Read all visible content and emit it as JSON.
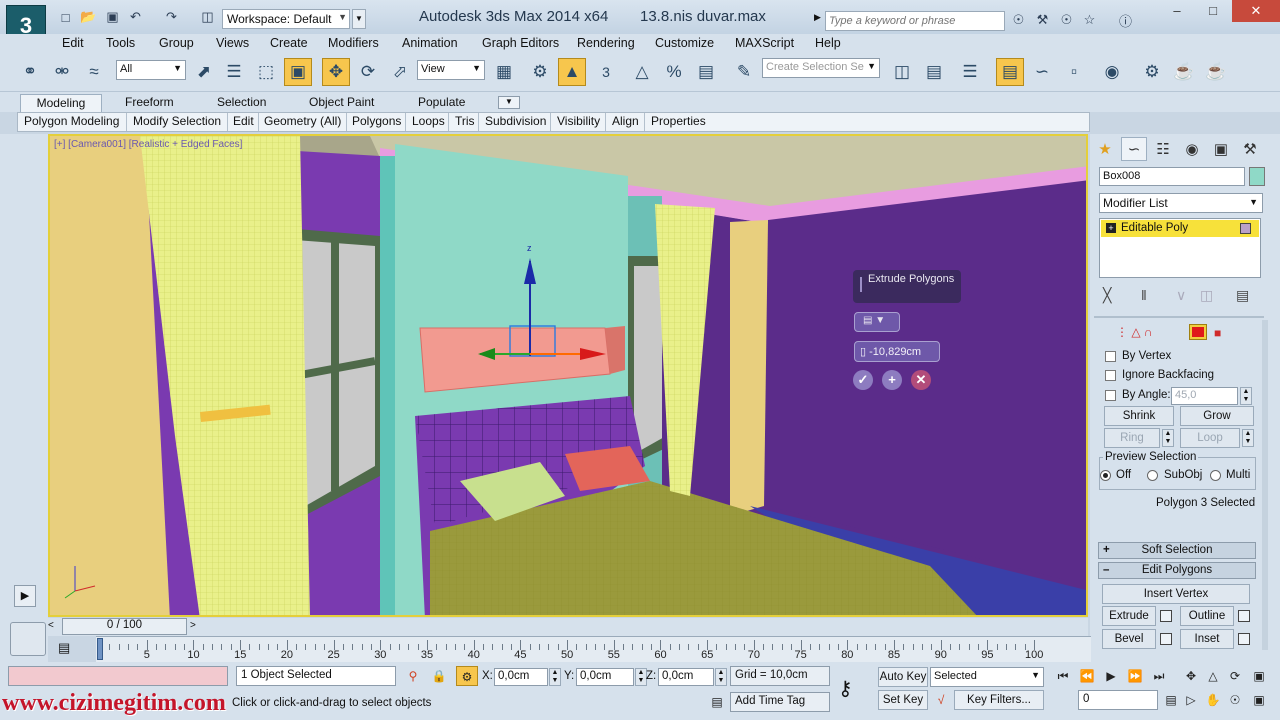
{
  "title_bar": {
    "workspace": "Workspace: Default",
    "app_title": "Autodesk 3ds Max  2014 x64",
    "file_name": "13.8.nis duvar.max",
    "search_placeholder": "Type a keyword or phrase"
  },
  "menu": [
    "Edit",
    "Tools",
    "Group",
    "Views",
    "Create",
    "Modifiers",
    "Animation",
    "Graph Editors",
    "Rendering",
    "Customize",
    "MAXScript",
    "Help"
  ],
  "main_toolbar": {
    "selection_filter": "All",
    "reference_coord": "View",
    "named_selection_placeholder": "Create Selection Se",
    "snap_label": "3"
  },
  "ribbon": {
    "tabs": [
      "Modeling",
      "Freeform",
      "Selection",
      "Object Paint",
      "Populate"
    ],
    "active_tab": "Modeling",
    "panels": [
      "Polygon Modeling",
      "Modify Selection",
      "Edit",
      "Geometry (All)",
      "Polygons",
      "Loops",
      "Tris",
      "Subdivision",
      "Visibility",
      "Align",
      "Properties"
    ]
  },
  "viewport": {
    "label": "[+] [Camera001] [Realistic + Edged Faces]",
    "caddy": {
      "title": "Extrude Polygons",
      "height_value": "-10,829cm"
    }
  },
  "command_panel": {
    "object_name": "Box008",
    "object_color": "#8fd9c7",
    "modifier_list": "Modifier List",
    "stack_item": "Editable Poly",
    "selection": {
      "by_vertex": "By Vertex",
      "ignore_backfacing": "Ignore Backfacing",
      "by_angle": "By Angle:",
      "angle_value": "45,0",
      "shrink": "Shrink",
      "grow": "Grow",
      "ring": "Ring",
      "loop": "Loop",
      "preview_selection": "Preview Selection",
      "preview_options": [
        "Off",
        "SubObj",
        "Multi"
      ],
      "selected_status": "Polygon 3 Selected"
    },
    "rollouts": {
      "soft_selection": "Soft Selection",
      "edit_polygons": "Edit Polygons"
    },
    "edit_polygons": {
      "insert_vertex": "Insert Vertex",
      "extrude": "Extrude",
      "outline": "Outline",
      "bevel": "Bevel",
      "inset": "Inset"
    }
  },
  "time_slider": {
    "frame": "0 / 100",
    "ticks": [
      "0",
      "5",
      "10",
      "15",
      "20",
      "25",
      "30",
      "35",
      "40",
      "45",
      "50",
      "55",
      "60",
      "65",
      "70",
      "75",
      "80",
      "85",
      "90",
      "95",
      "100"
    ]
  },
  "status_bar": {
    "selection_status": "1 Object Selected",
    "prompt": "Click or click-and-drag to select objects",
    "x_label": "X:",
    "x_value": "0,0cm",
    "y_label": "Y:",
    "y_value": "0,0cm",
    "z_label": "Z:",
    "z_value": "0,0cm",
    "grid": "Grid = 10,0cm",
    "add_time_tag": "Add Time Tag",
    "auto_key": "Auto Key",
    "set_key": "Set Key",
    "key_mode": "Selected",
    "key_filters": "Key Filters...",
    "current_frame": "0"
  },
  "watermark": "www.cizimegitim.com"
}
